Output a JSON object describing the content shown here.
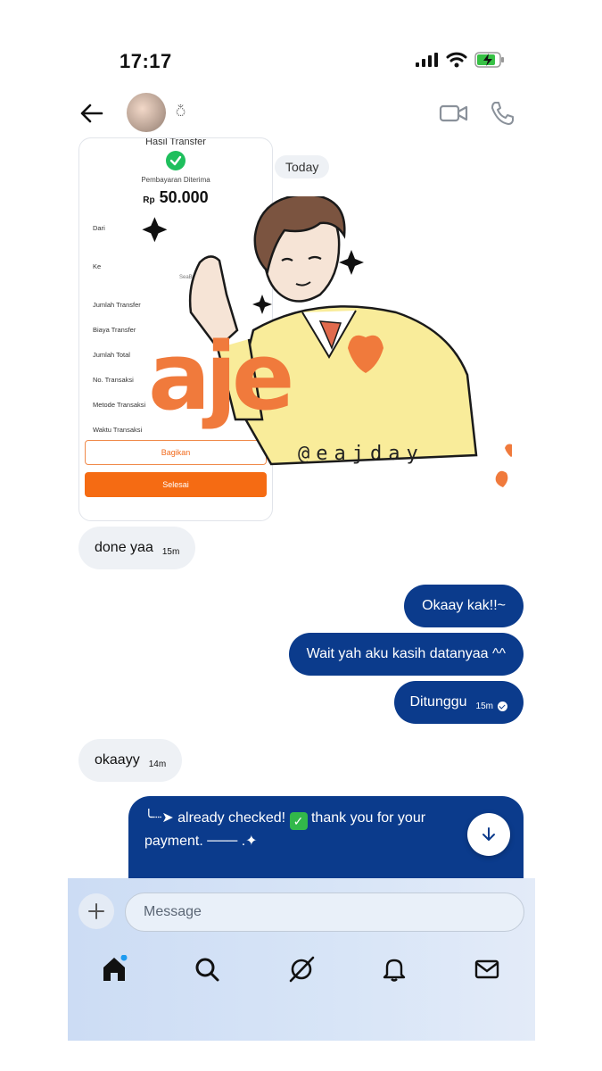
{
  "status_bar": {
    "time": "17:17"
  },
  "header": {
    "contact_name": "ঁ"
  },
  "date_chip": "Today",
  "receipt": {
    "title": "Hasil Transfer",
    "status": "Pembayaran Diterima",
    "currency": "Rp",
    "amount": "50.000",
    "rows": [
      "Dari",
      "Ke",
      "Jumlah Transfer",
      "Biaya Transfer",
      "Jumlah Total",
      "No. Transaksi",
      "Metode Transaksi",
      "Waktu Transaksi"
    ],
    "bank": "SeaBank",
    "share_label": "Bagikan",
    "done_label": "Selesai"
  },
  "messages": [
    {
      "side": "in",
      "text": "done yaa",
      "time": "15m"
    },
    {
      "side": "out",
      "text": "Okaay kak!!~"
    },
    {
      "side": "out",
      "text": "Wait yah aku kasih datanyaa ^^"
    },
    {
      "side": "out",
      "text": "Ditunggu",
      "time": "15m",
      "read": true
    },
    {
      "side": "in",
      "text": "okaayy",
      "time": "14m"
    }
  ],
  "long_message": {
    "line1_a": "╰┈➤ already checked!",
    "line1_b": "thank you for your",
    "line2": "payment. ─── .✦"
  },
  "sticker": {
    "brand": "aje",
    "handle": "@eajday"
  },
  "composer": {
    "placeholder": "Message"
  },
  "bottom_nav": [
    "home",
    "search",
    "grok",
    "notifications",
    "messages"
  ],
  "colors": {
    "accent": "#0b3b8c",
    "incoming": "#eef1f5",
    "receipt_orange": "#f56b13",
    "sticker_orange": "#f07a3c"
  }
}
